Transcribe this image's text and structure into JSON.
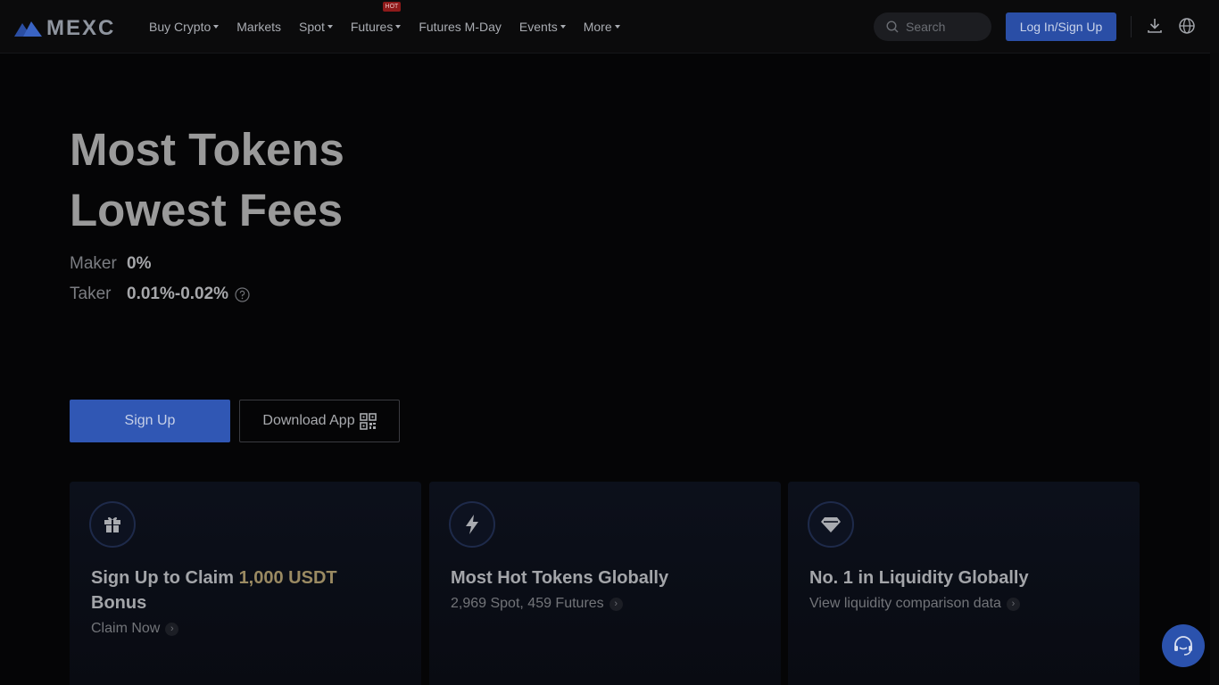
{
  "brand": {
    "name": "MEXC"
  },
  "nav": {
    "items": [
      {
        "label": "Buy Crypto",
        "dropdown": true
      },
      {
        "label": "Markets",
        "dropdown": false
      },
      {
        "label": "Spot",
        "dropdown": true
      },
      {
        "label": "Futures",
        "dropdown": true,
        "badge": "HOT"
      },
      {
        "label": "Futures M-Day",
        "dropdown": false
      },
      {
        "label": "Events",
        "dropdown": true
      },
      {
        "label": "More",
        "dropdown": true
      }
    ]
  },
  "header": {
    "search_placeholder": "Search",
    "login_label": "Log In/Sign Up",
    "icons": [
      "download-icon",
      "globe-icon"
    ]
  },
  "hero": {
    "title_line1": "Most Tokens",
    "title_line2": "Lowest Fees",
    "maker_label": "Maker",
    "maker_value": "0%",
    "taker_label": "Taker",
    "taker_value": "0.01%-0.02%",
    "signup_label": "Sign Up",
    "download_label": "Download App"
  },
  "cards": [
    {
      "icon": "gift-icon",
      "title_prefix": "Sign Up to Claim ",
      "title_highlight": "1,000 USDT",
      "title_suffix": "Bonus",
      "link": "Claim Now"
    },
    {
      "icon": "lightning-icon",
      "title": "Most Hot Tokens Globally",
      "link": "2,969 Spot, 459 Futures"
    },
    {
      "icon": "diamond-icon",
      "title": "No. 1 in Liquidity Globally",
      "link": "View liquidity comparison data"
    }
  ],
  "colors": {
    "accent": "#2a4ea6",
    "highlight": "#9a8a62",
    "hot_badge": "#8e1a1a"
  },
  "support": {
    "icon": "headset-icon"
  }
}
